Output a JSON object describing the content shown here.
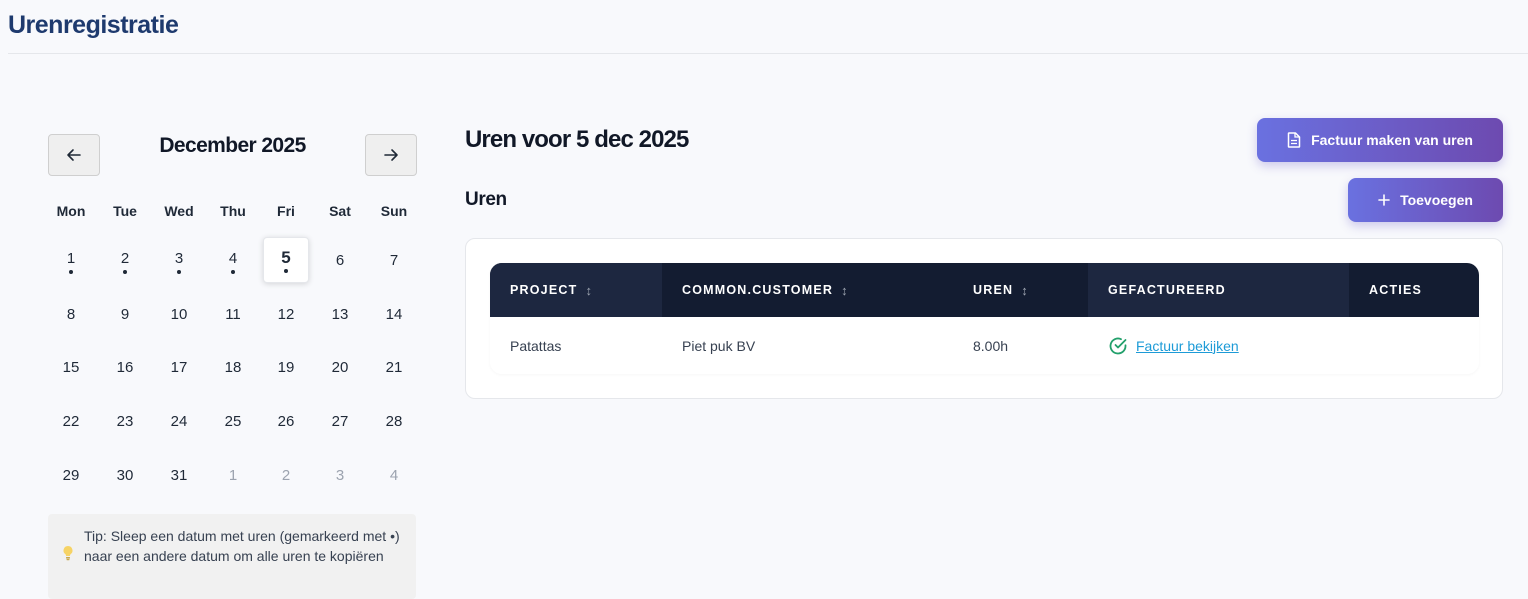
{
  "header": {
    "title": "Urenregistratie"
  },
  "calendar": {
    "month_title": "December 2025",
    "prev_label": "←",
    "next_label": "→",
    "weekdays": [
      "Mon",
      "Tue",
      "Wed",
      "Thu",
      "Fri",
      "Sat",
      "Sun"
    ],
    "weeks": [
      [
        "1",
        "2",
        "3",
        "4",
        "5",
        "6",
        "7"
      ],
      [
        "8",
        "9",
        "10",
        "11",
        "12",
        "13",
        "14"
      ],
      [
        "15",
        "16",
        "17",
        "18",
        "19",
        "20",
        "21"
      ],
      [
        "22",
        "23",
        "24",
        "25",
        "26",
        "27",
        "28"
      ],
      [
        "29",
        "30",
        "31",
        "1",
        "2",
        "3",
        "4"
      ]
    ],
    "days_with_hours": [
      "1",
      "2",
      "3",
      "4",
      "5"
    ],
    "selected_day": "5"
  },
  "tip": {
    "text": "Tip: Sleep een datum met uren (gemarkeerd met •) naar een andere datum om alle uren te kopiëren"
  },
  "main": {
    "title": "Uren voor 5 dec 2025",
    "invoice_button": "Factuur maken van uren",
    "section_title": "Uren",
    "add_button": "Toevoegen"
  },
  "table": {
    "columns": {
      "project": "PROJECT",
      "customer": "COMMON.CUSTOMER",
      "hours": "UREN",
      "invoiced": "GEFACTUREERD",
      "actions": "ACTIES"
    },
    "sort_icon": "↕",
    "rows": [
      {
        "project": "Patattas",
        "customer": "Piet puk BV",
        "hours": "8.00h",
        "invoice_link": "Factuur bekijken"
      }
    ]
  },
  "colors": {
    "title": "#1e3a6e",
    "table_header": "#131c31",
    "button_gradient_start": "#6a71e0",
    "button_gradient_end": "#6d4ab0",
    "link": "#1d9bd7",
    "check": "#22a06b"
  }
}
